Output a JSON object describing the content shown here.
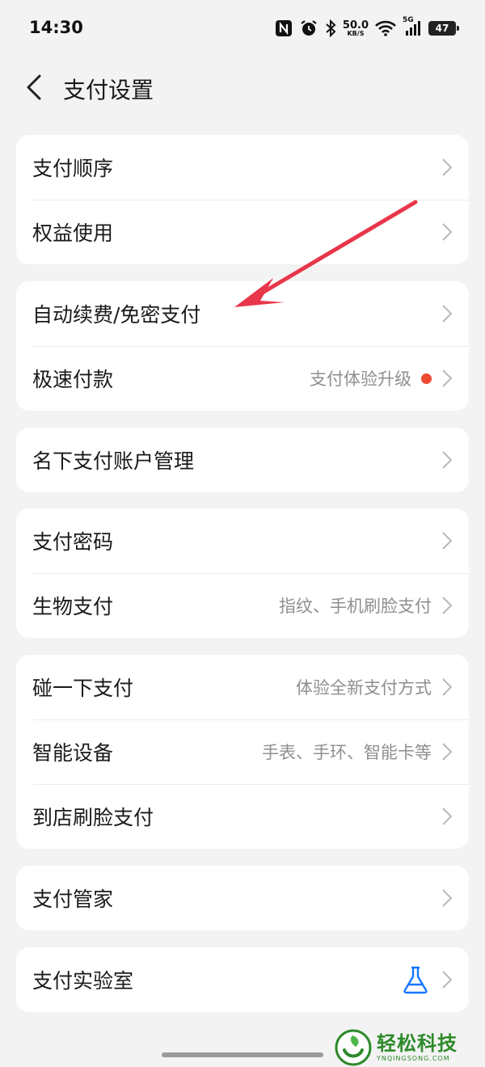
{
  "status_bar": {
    "time": "14:30",
    "net_speed_value": "50.0",
    "net_speed_unit": "KB/S",
    "network_type": "5G",
    "battery": "47",
    "icons": [
      "nfc-icon",
      "alarm-icon",
      "bluetooth-icon",
      "wifi-icon",
      "signal-icon",
      "battery-icon"
    ]
  },
  "header": {
    "title": "支付设置"
  },
  "groups": [
    {
      "items": [
        {
          "label": "支付顺序",
          "hint": ""
        },
        {
          "label": "权益使用",
          "hint": ""
        }
      ]
    },
    {
      "items": [
        {
          "label": "自动续费/免密支付",
          "hint": ""
        },
        {
          "label": "极速付款",
          "hint": "支付体验升级",
          "badge": "red-dot"
        }
      ]
    },
    {
      "items": [
        {
          "label": "名下支付账户管理",
          "hint": ""
        }
      ]
    },
    {
      "items": [
        {
          "label": "支付密码",
          "hint": ""
        },
        {
          "label": "生物支付",
          "hint": "指纹、手机刷脸支付"
        }
      ]
    },
    {
      "items": [
        {
          "label": "碰一下支付",
          "hint": "体验全新支付方式"
        },
        {
          "label": "智能设备",
          "hint": "手表、手环、智能卡等"
        },
        {
          "label": "到店刷脸支付",
          "hint": ""
        }
      ]
    },
    {
      "items": [
        {
          "label": "支付管家",
          "hint": ""
        }
      ]
    },
    {
      "items": [
        {
          "label": "支付实验室",
          "hint": "",
          "icon": "flask-icon"
        }
      ]
    }
  ],
  "colors": {
    "background": "#f3f3f3",
    "card": "#ffffff",
    "annotation_arrow": "#e8364a",
    "badge": "#ee4a2f",
    "lab_icon": "#1677ff",
    "watermark": "#2d8a2a"
  },
  "watermark": {
    "text_cn": "轻松科技",
    "text_en": "YNQINGSONG.COM"
  }
}
